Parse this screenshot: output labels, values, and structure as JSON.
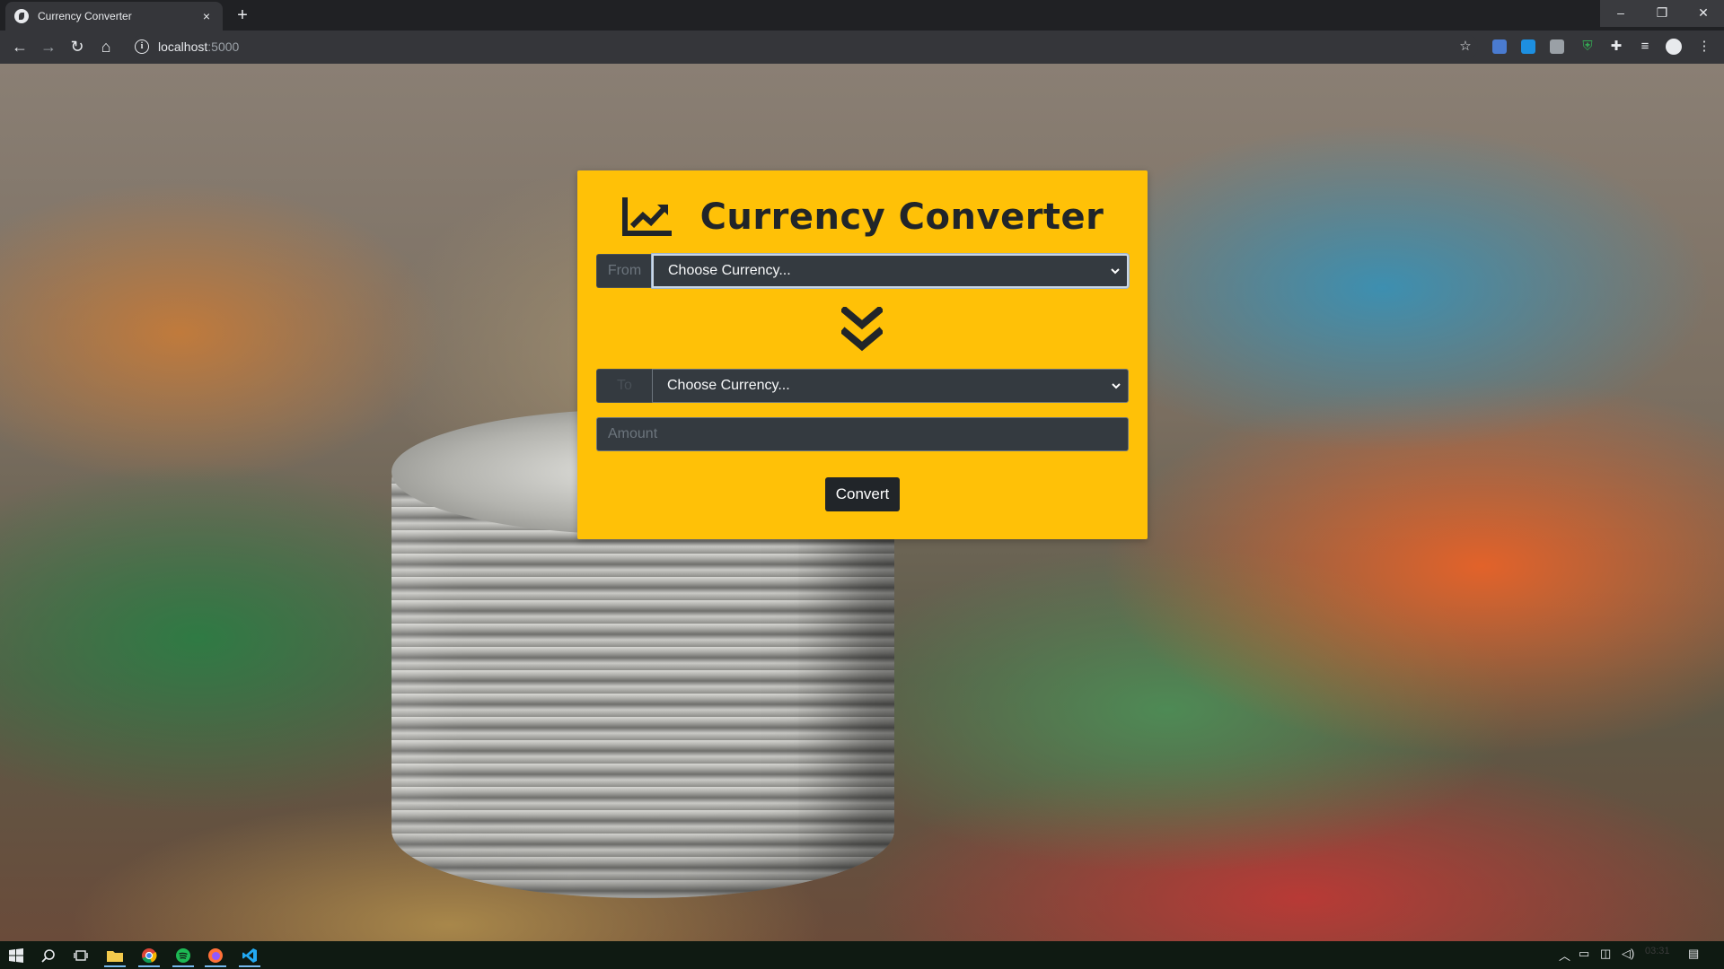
{
  "browser": {
    "tab_title": "Currency Converter",
    "tab_close": "×",
    "new_tab": "+",
    "url_host": "localhost",
    "url_port": ":5000",
    "window_controls": {
      "minimize": "–",
      "maximize": "❐",
      "close": "✕"
    },
    "nav": {
      "back": "←",
      "forward": "→",
      "reload": "↻",
      "home": "⌂"
    },
    "bookmark_star": "☆"
  },
  "converter": {
    "title": "Currency Converter",
    "from_label": "From",
    "to_label": "To",
    "from_select_value": "Choose Currency...",
    "to_select_value": "Choose Currency...",
    "amount_placeholder": "Amount",
    "convert_label": "Convert"
  },
  "taskbar": {
    "clock": "03:31"
  },
  "colors": {
    "card_background": "#ffc107",
    "input_background": "#343a40",
    "button_background": "#212529"
  }
}
